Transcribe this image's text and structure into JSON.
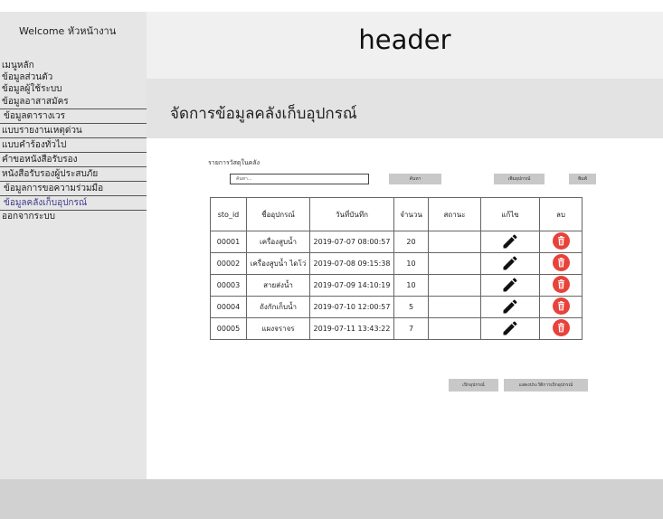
{
  "sidebar": {
    "welcome": "Welcome หัวหน้างาน",
    "items": [
      {
        "label": "เมนูหลัก"
      },
      {
        "label": "ข้อมูลส่วนตัว"
      },
      {
        "label": "ข้อมูลผู้ใช้ระบบ"
      },
      {
        "label": "ข้อมูลอาสาสมัคร"
      },
      {
        "label": "ข้อมูลตารางเวร"
      },
      {
        "label": "แบบรายงานเหตุด่วน"
      },
      {
        "label": "แบบคำร้องทั่วไป"
      },
      {
        "label": "คำขอหนังสือรับรอง"
      },
      {
        "label": "หนังสือรับรองผู้ประสบภัย"
      },
      {
        "label": "ข้อมูลการขอความร่วมมือ"
      },
      {
        "label": "ข้อมูลคลังเก็บอุปกรณ์"
      },
      {
        "label": "ออกจากระบบ"
      }
    ]
  },
  "header": {
    "title": "header"
  },
  "page": {
    "title": "จัดการข้อมูลคลังเก็บอุปกรณ์"
  },
  "toolbar": {
    "list_label": "รายการวัสดุในคลัง",
    "search_placeholder": "ค้นหา...",
    "search_button": "ค้นหา",
    "add_button": "เพิ่มอุปกรณ์",
    "print_button": "พิมพ์"
  },
  "table": {
    "headers": [
      "sto_id",
      "ชื่ออุปกรณ์",
      "วันที่บันทึก",
      "จำนวน",
      "สถานะ",
      "แก้ไข",
      "ลบ"
    ],
    "rows": [
      {
        "id": "00001",
        "name": "เครื่องสูบน้ำ",
        "date": "2019-07-07 08:00:57",
        "qty": "20",
        "status": ""
      },
      {
        "id": "00002",
        "name": "เครื่องสูบน้ำ ไดโว่",
        "date": "2019-07-08 09:15:38",
        "qty": "10",
        "status": ""
      },
      {
        "id": "00003",
        "name": "สายส่งน้ำ",
        "date": "2019-07-09 14:10:19",
        "qty": "10",
        "status": ""
      },
      {
        "id": "00004",
        "name": "ถังกักเก็บน้ำ",
        "date": "2019-07-10 12:00:57",
        "qty": "5",
        "status": ""
      },
      {
        "id": "00005",
        "name": "แผงจราจร",
        "date": "2019-07-11 13:43:22",
        "qty": "7",
        "status": ""
      }
    ]
  },
  "actions": {
    "borrow_button": "เบิกอุปกรณ์",
    "history_button": "แสดงประวัติการเบิกอุปกรณ์"
  },
  "icons": {
    "edit": "pencil-icon",
    "delete": "trash-icon"
  },
  "colors": {
    "delete": "#e8423a",
    "active_menu": "#3d3a8c"
  }
}
